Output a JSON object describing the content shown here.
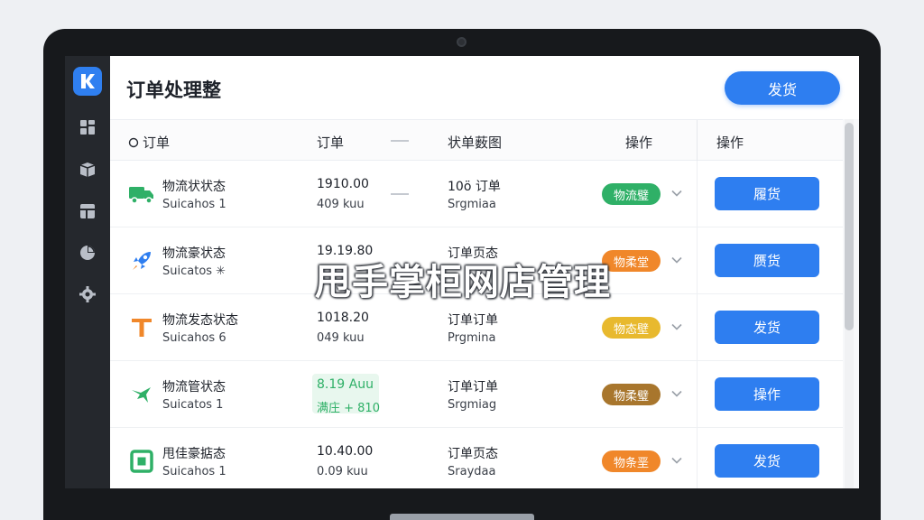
{
  "app": {
    "title": "订单处理整",
    "primary_action": "发货",
    "overlay_text": "甩手掌柜网店管理"
  },
  "sidebar": {
    "logo_icon": "k-logo-icon",
    "items": [
      {
        "icon": "grid-icon"
      },
      {
        "icon": "box-icon"
      },
      {
        "icon": "layout-icon"
      },
      {
        "icon": "pie-chart-icon"
      },
      {
        "icon": "gear-icon"
      }
    ]
  },
  "table": {
    "headers": {
      "col1": "订单",
      "col2": "订单",
      "col3": "状单薮图",
      "col4": "操作",
      "col5": "操作"
    },
    "rows": [
      {
        "icon": "truck-icon",
        "name": "物流状状态",
        "sub": "Suicahos 1",
        "time": "1910.00",
        "amount": "409 kuu",
        "order": "10ö 订单",
        "order_sub": "Srgmiaa",
        "badge": "物流璧",
        "badge_color": "#2fb067",
        "action": "履货",
        "highlight": false
      },
      {
        "icon": "rocket-icon",
        "name": "物流豪状态",
        "sub": "Suicatos ✳",
        "time": "19.19.80",
        "amount": "",
        "order": "订单页态",
        "order_sub": "",
        "badge": "物柔堂",
        "badge_color": "#f0872a",
        "action": "赝货",
        "highlight": false
      },
      {
        "icon": "t-icon",
        "name": "物流发态状态",
        "sub": "Suicahos 6",
        "time": "1018.20",
        "amount": "049 kuu",
        "order": "订单订单",
        "order_sub": "Prgmina",
        "badge": "物态壁",
        "badge_color": "#e8b92e",
        "action": "发货",
        "highlight": false
      },
      {
        "icon": "plane-icon",
        "name": "物流管状态",
        "sub": "Suicatos 1",
        "time": "8.19 Auu",
        "amount": "满庄 + 810",
        "order": "订单订单",
        "order_sub": "Srgmiag",
        "badge": "物柔璧",
        "badge_color": "#a8762d",
        "action": "操作",
        "highlight": true
      },
      {
        "icon": "square-icon",
        "name": "甩佳豪掂态",
        "sub": "Suicahos 1",
        "time": "10.40.00",
        "amount": "0.09 kuu",
        "order": "订单页态",
        "order_sub": "Sraydaa",
        "badge": "物条垩",
        "badge_color": "#f0872a",
        "action": "发货",
        "highlight": false
      }
    ]
  }
}
